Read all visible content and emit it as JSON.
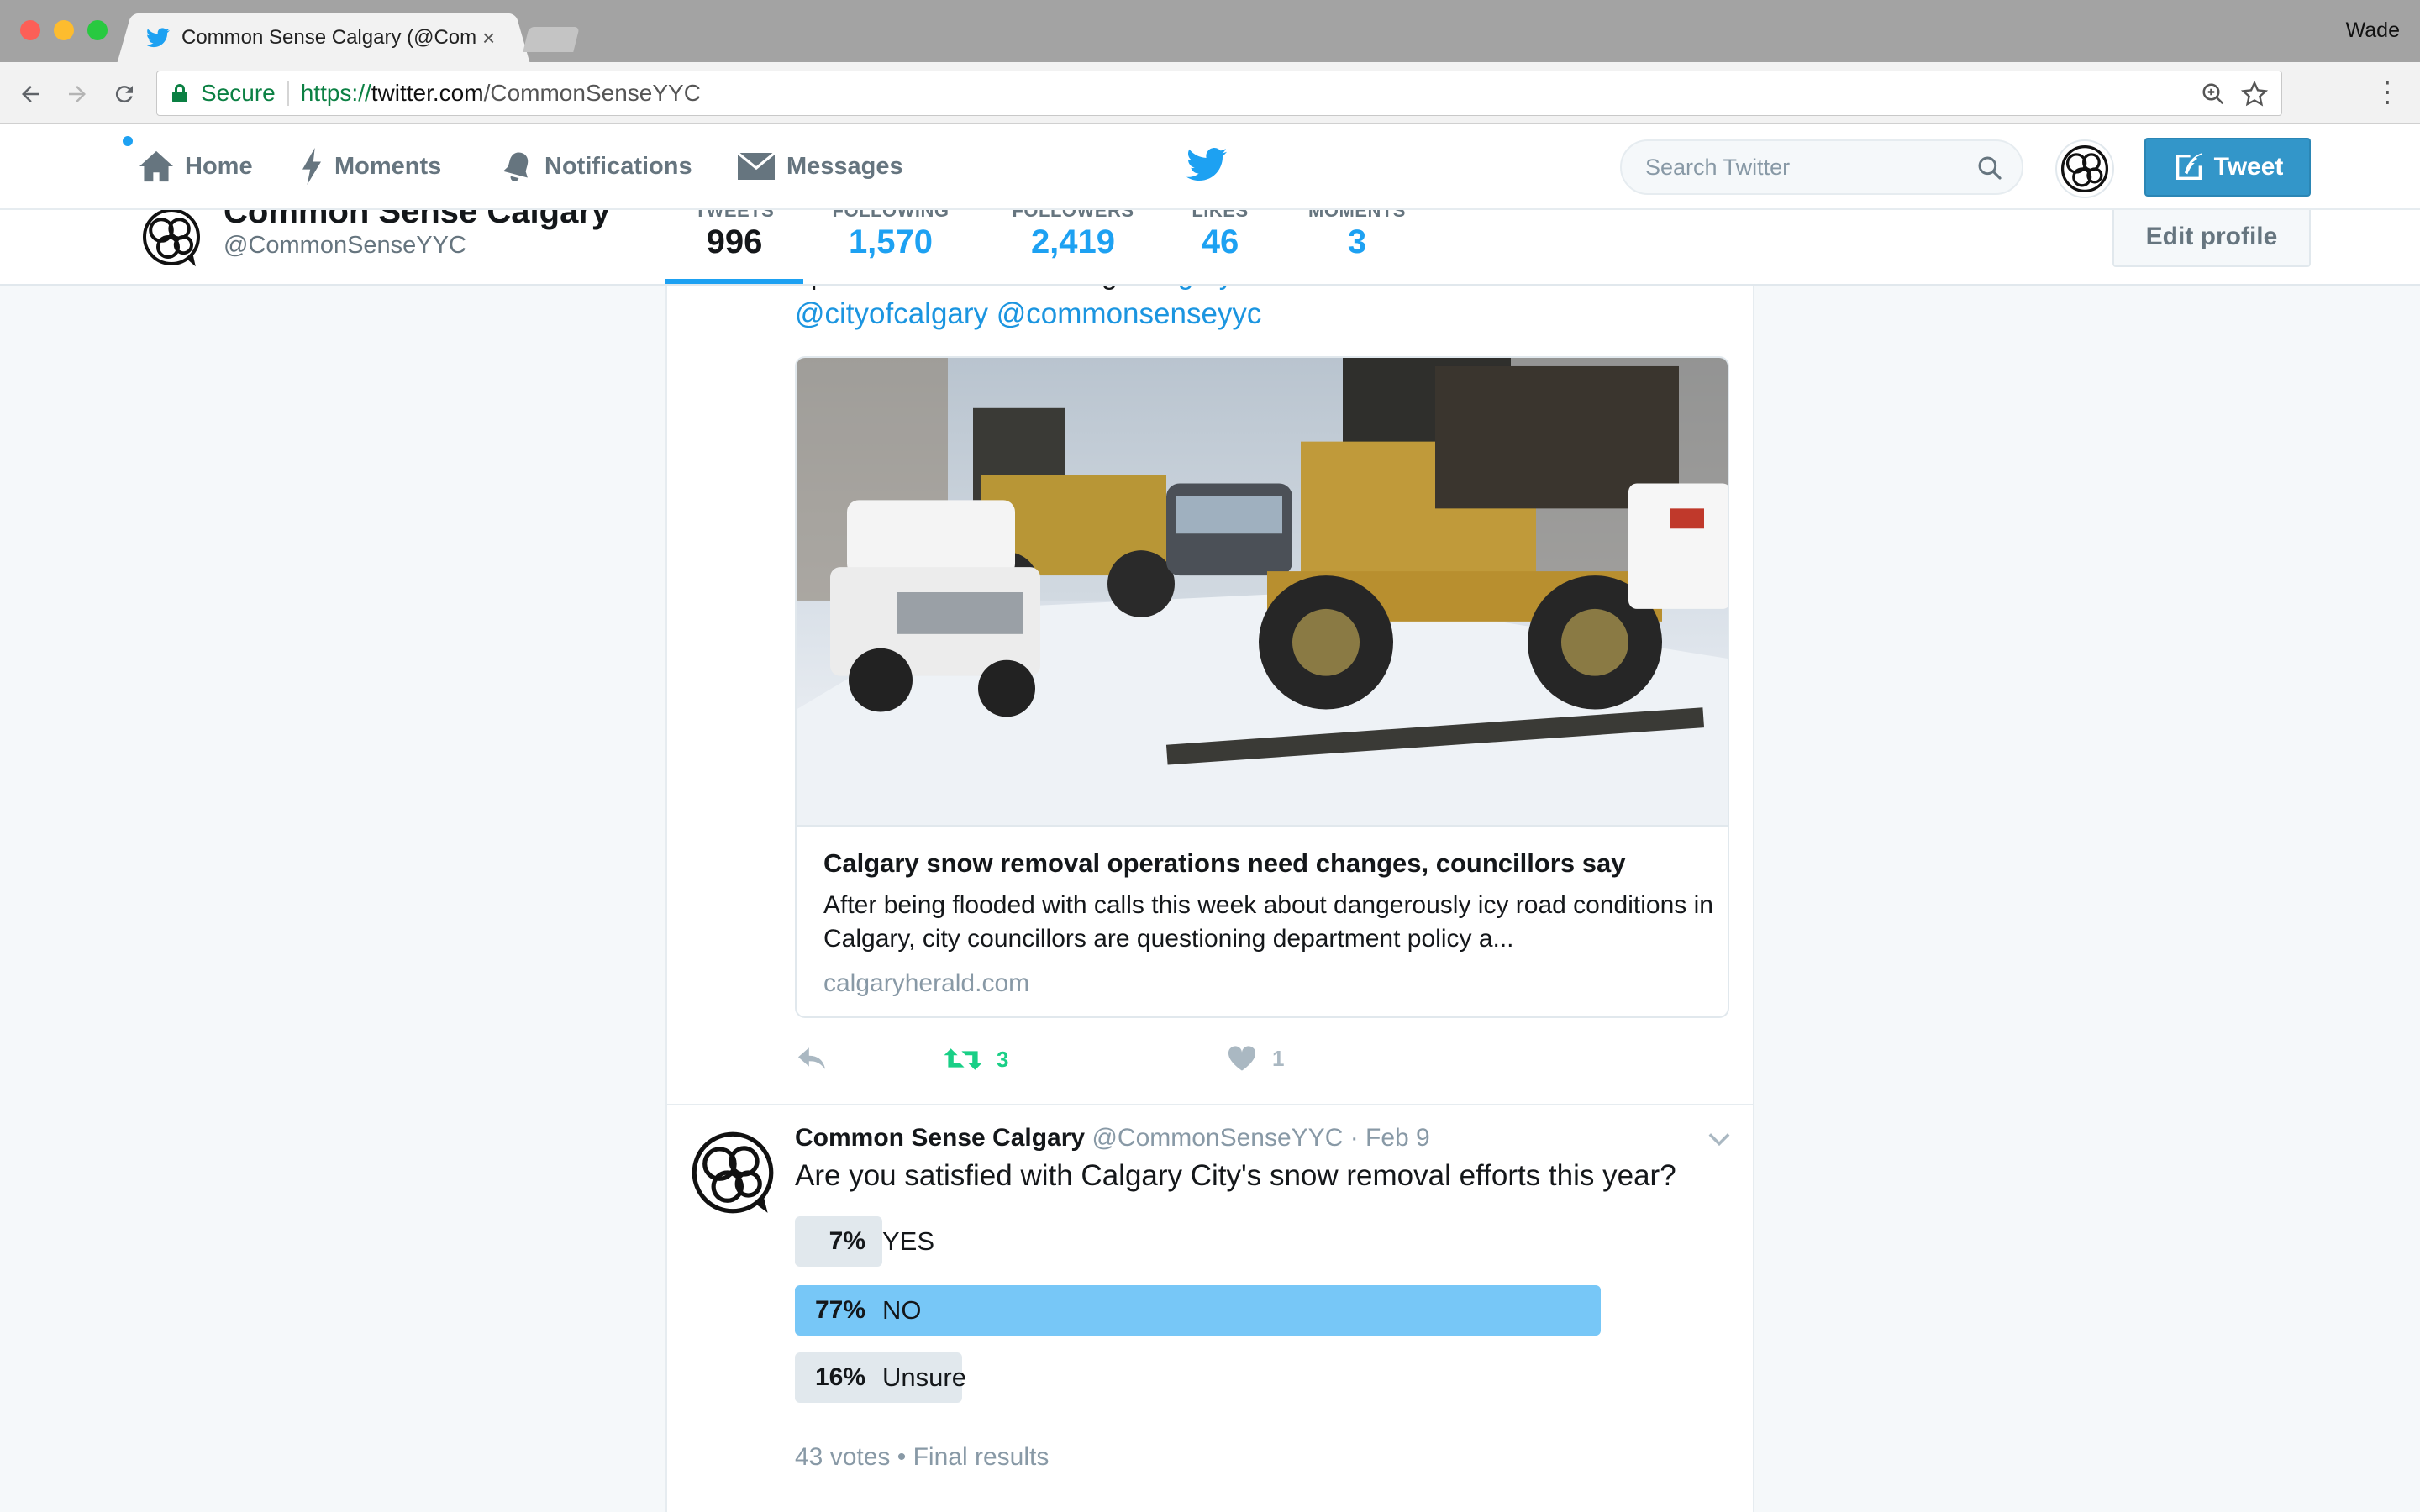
{
  "browser": {
    "tab_title": "Common Sense Calgary (@CommonSenseYYC) | Twitter",
    "user": "Wade",
    "secure_label": "Secure",
    "url_scheme": "https://",
    "url_host": "twitter.com",
    "url_path": "/CommonSenseYYC"
  },
  "nav": {
    "home": "Home",
    "moments": "Moments",
    "notifications": "Notifications",
    "messages": "Messages",
    "search_placeholder": "Search Twitter",
    "tweet_button": "Tweet"
  },
  "profile": {
    "name": "Common Sense Calgary",
    "handle": "@CommonSenseYYC",
    "edit_button": "Edit profile",
    "stats": [
      {
        "label": "TWEETS",
        "value": "996"
      },
      {
        "label": "FOLLOWING",
        "value": "1,570"
      },
      {
        "label": "FOLLOWERS",
        "value": "2,419"
      },
      {
        "label": "LIKES",
        "value": "46"
      },
      {
        "label": "MOMENTS",
        "value": "3"
      }
    ]
  },
  "tweet1": {
    "partial_text": "operations need to change",
    "partial_link": "calgaryherald.com/news/traffic/w...",
    "mentions": "@cityofcalgary @commonsenseyyc",
    "card_title": "Calgary snow removal operations need changes, councillors say",
    "card_description": "After being flooded with calls this week about dangerously icy road conditions in Calgary, city councillors are questioning department policy a...",
    "card_domain": "calgaryherald.com",
    "retweets": "3",
    "likes": "1"
  },
  "tweet2": {
    "name": "Common Sense Calgary",
    "handle": "@CommonSenseYYC",
    "separator": " · ",
    "date": "Feb 9",
    "text": "Are you satisfied with Calgary City's snow removal efforts this year?",
    "poll": [
      {
        "percent_label": "7%",
        "label": "YES",
        "percent": 7,
        "winner": false
      },
      {
        "percent_label": "77%",
        "label": "NO",
        "percent": 77,
        "winner": true
      },
      {
        "percent_label": "16%",
        "label": "Unsure",
        "percent": 16,
        "winner": false
      }
    ],
    "votes": "43 votes",
    "footer_sep": " • ",
    "status": "Final results"
  },
  "colors": {
    "twitter_blue": "#1da1f2",
    "retweet_green": "#19cf86",
    "poll_winner": "#77c7f7",
    "poll_other": "#e1e8ed"
  }
}
